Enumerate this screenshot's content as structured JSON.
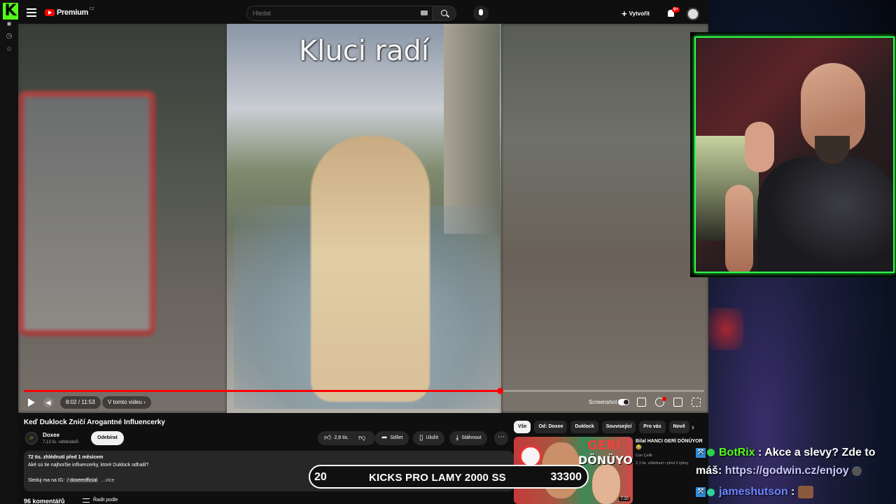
{
  "kick": {
    "logo": "K",
    "icons": [
      "home-icon",
      "clock-icon",
      "star-icon"
    ]
  },
  "yt": {
    "logo_text": "Premium",
    "logo_region": "CZ",
    "search_placeholder": "Hledat",
    "create_label": "Vytvořit",
    "notification_badge": "9+",
    "video_caption": "Kluci radí",
    "progress_fraction": 0.7,
    "time": "8:02 / 11:53",
    "chapter": "V tomto videu ›",
    "screenshot_label": "Screenshot",
    "title": "Keď Duklock Zničí Arogantné Influencerky",
    "channel_name": "Doxee",
    "channel_subs": "7,13 tis. odběratelů",
    "subscribe_label": "Odebírat",
    "like_count": "2,8 tis.",
    "share_label": "Sdílet",
    "save_label": "Uložit",
    "download_label": "Stáhnout",
    "description": {
      "views": "72 tis. zhlédnutí  před 1 měsícem",
      "text": "Aké sú tie najhoršie influencerky, ktoré Duklock odhalil?",
      "ig_prefix": "Sleduj ma na IG: ",
      "ig_handle": "/ doxeeofficial",
      "more": "...více"
    },
    "comments_count": "96 komentářů",
    "sort_label": "Řadit podle",
    "chips": [
      "Vše",
      "Od: Doxee",
      "Duklock",
      "Související",
      "Pro vás",
      "Nově"
    ],
    "recommended": {
      "title": "Bilal HANCI GERİ DÖNÜYOR 😂",
      "channel": "Can Çelik",
      "meta": "2,1 tis. zhlédnutí • před 2 týdny",
      "duration": "7:20",
      "thumb_text_1": "GERİ",
      "thumb_text_2": "DÖNÜYOR"
    }
  },
  "kicks_bar": {
    "left_value": "20",
    "label": "KICKS PRO LAMY 2000 SS",
    "right_value": "33300"
  },
  "chat": [
    {
      "user": "BotRix",
      "message": " : Akce a slevy? Zde to",
      "continuation": "máš: ",
      "link": "https://godwin.cz/enjoy"
    },
    {
      "user": "jameshutson",
      "message": " :"
    }
  ],
  "colors": {
    "accent_green": "#53fc18",
    "yt_red": "#ff0000",
    "webcam_border": "#2bff4a"
  }
}
